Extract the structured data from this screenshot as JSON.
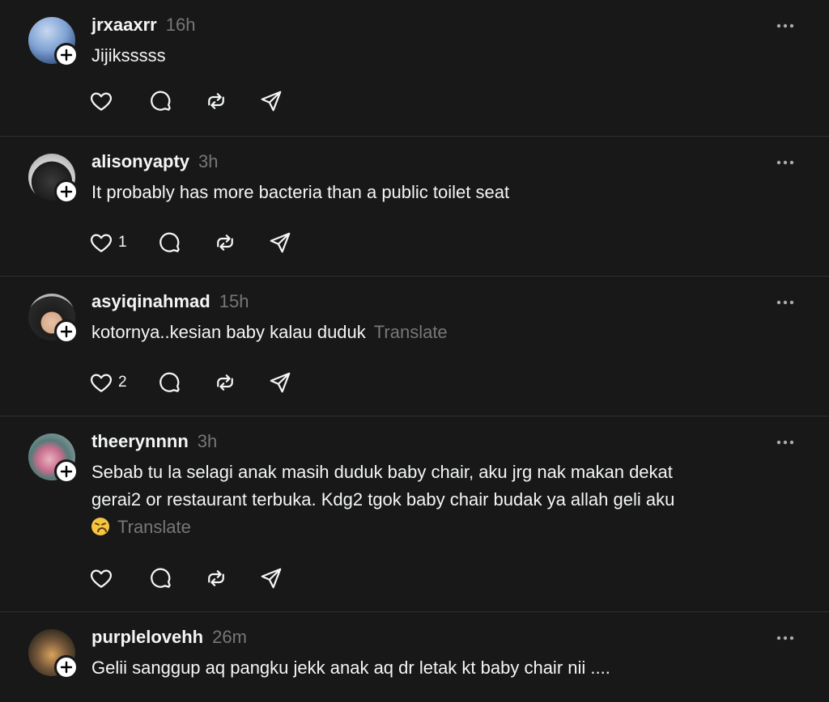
{
  "posts": [
    {
      "username": "jrxaaxrr",
      "time": "16h",
      "text": "Jijiksssss",
      "translate": "",
      "likes": ""
    },
    {
      "username": "alisonyapty",
      "time": "3h",
      "text": "It probably has more bacteria than a public toilet seat",
      "translate": "",
      "likes": "1"
    },
    {
      "username": "asyiqinahmad",
      "time": "15h",
      "text": "kotornya..kesian baby kalau duduk",
      "translate": "Translate",
      "likes": "2"
    },
    {
      "username": "theerynnnn",
      "time": "3h",
      "text_line1": "Sebab tu la selagi anak masih duduk baby chair, aku jrg nak makan dekat",
      "text_line2": "gerai2 or restaurant terbuka. Kdg2 tgok baby chair budak ya allah geli aku",
      "translate": "Translate",
      "emoji": "confounded-face",
      "likes": ""
    },
    {
      "username": "purplelovehh",
      "time": "26m",
      "text": "Gelii sanggup aq pangku jekk anak aq dr letak kt baby chair nii ....",
      "translate": "",
      "likes": ""
    }
  ],
  "icons": {
    "like": "heart-icon",
    "reply": "speech-bubble-icon",
    "repost": "repost-icon",
    "share": "send-icon",
    "more": "more-dots-icon",
    "follow": "plus-icon"
  },
  "colors": {
    "background": "#181818",
    "text": "#f3f5f7",
    "muted": "#777777",
    "divider": "#2f2f2f"
  }
}
